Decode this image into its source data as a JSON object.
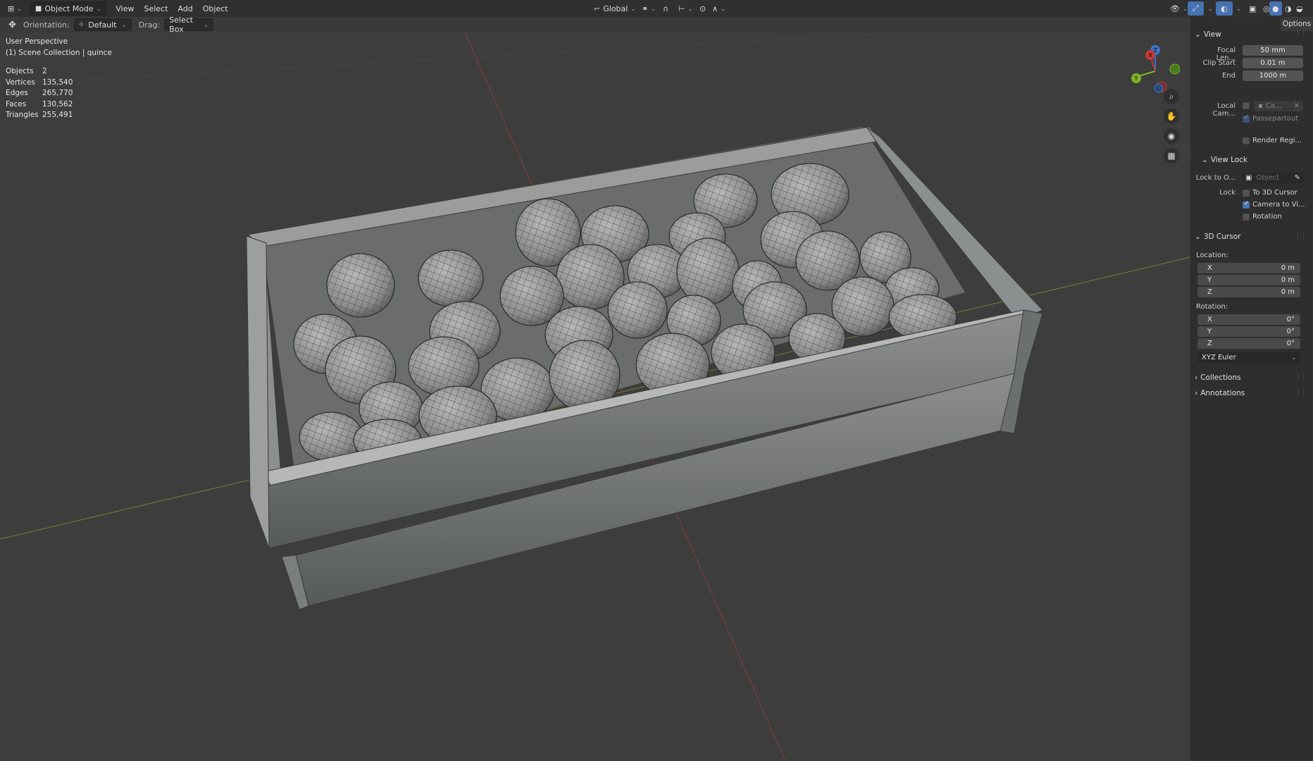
{
  "topbar": {
    "mode": "Object Mode",
    "menu": [
      "View",
      "Select",
      "Add",
      "Object"
    ],
    "transform_space": "Global"
  },
  "toolbar": {
    "orientation_label": "Orientation:",
    "orientation_value": "Default",
    "drag_label": "Drag:",
    "drag_value": "Select Box"
  },
  "viewport": {
    "perspective": "User Perspective",
    "collection": "(1) Scene Collection | quince",
    "stats": [
      {
        "label": "Objects",
        "value": "2"
      },
      {
        "label": "Vertices",
        "value": "135,540"
      },
      {
        "label": "Edges",
        "value": "265,770"
      },
      {
        "label": "Faces",
        "value": "130,562"
      },
      {
        "label": "Triangles",
        "value": "255,491"
      }
    ],
    "gizmo": {
      "x": "X",
      "y": "Y",
      "z": "Z"
    }
  },
  "sidebar": {
    "tab": "Options",
    "view": {
      "title": "View",
      "focal_label": "Focal Len...",
      "focal_value": "50 mm",
      "clip_start_label": "Clip Start",
      "clip_start_value": "0.01 m",
      "end_label": "End",
      "end_value": "1000 m",
      "local_cam_label": "Local Cam...",
      "local_cam_value": "Ca...",
      "passepartout": "Passepartout",
      "render_region": "Render Regi..."
    },
    "view_lock": {
      "title": "View Lock",
      "lock_to_label": "Lock to O...",
      "lock_to_placeholder": "Object",
      "lock_label": "Lock",
      "to_cursor": "To 3D Cursor",
      "camera_to_view": "Camera to Vi...",
      "rotation": "Rotation"
    },
    "cursor": {
      "title": "3D Cursor",
      "location_label": "Location:",
      "location": [
        {
          "axis": "X",
          "value": "0 m"
        },
        {
          "axis": "Y",
          "value": "0 m"
        },
        {
          "axis": "Z",
          "value": "0 m"
        }
      ],
      "rotation_label": "Rotation:",
      "rotation": [
        {
          "axis": "X",
          "value": "0°"
        },
        {
          "axis": "Y",
          "value": "0°"
        },
        {
          "axis": "Z",
          "value": "0°"
        }
      ],
      "mode": "XYZ Euler"
    },
    "collections": "Collections",
    "annotations": "Annotations"
  }
}
